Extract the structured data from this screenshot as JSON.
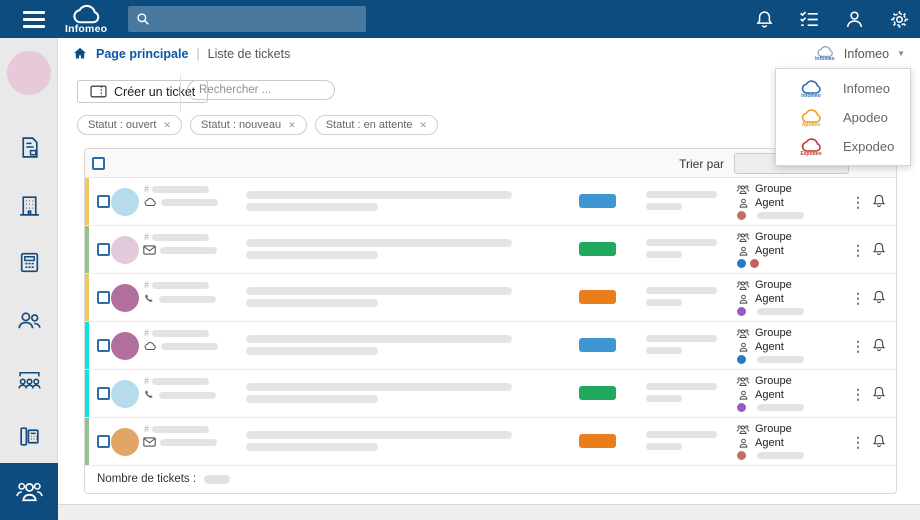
{
  "topbar": {
    "brand": "Infomeo",
    "global_search_value": "",
    "icons": [
      "bell-icon",
      "task-list-icon",
      "user-icon",
      "gear-icon"
    ],
    "color": "#0d4c7e"
  },
  "breadcrumb": {
    "primary": "Page principale",
    "separator": "|",
    "secondary": "Liste de tickets"
  },
  "company_selector": {
    "selected": "Infomeo"
  },
  "company_menu": {
    "items": [
      {
        "label": "Infomeo",
        "logo_color": "#2b6cb5"
      },
      {
        "label": "Apodeo",
        "logo_color": "#f39c12"
      },
      {
        "label": "Expodeo",
        "logo_color": "#c0392b"
      }
    ]
  },
  "toolbar": {
    "create_label": "Créer un ticket",
    "search_placeholder": "Rechercher ..."
  },
  "filters": [
    {
      "label": "Statut : ouvert"
    },
    {
      "label": "Statut : nouveau"
    },
    {
      "label": "Statut : en attente"
    }
  ],
  "sidebar": {
    "avatar_color": "#e7c9d9",
    "items": [
      "document-icon",
      "building-icon",
      "calculator-icon",
      "users-icon",
      "meeting-icon",
      "fax-icon",
      "team-icon"
    ],
    "active_item": "team-icon"
  },
  "table": {
    "sort_label": "Trier par",
    "group_label": "Groupe",
    "agent_label": "Agent",
    "footer_label": "Nombre de tickets :",
    "rows": [
      {
        "accent": "#f1c860",
        "avatar": "#b7dbee",
        "channel": "cloud",
        "badge": "#3e97d3",
        "dots": [
          "#c66d63"
        ],
        "dot_skeleton": true,
        "extra_line": false
      },
      {
        "accent": "#97c08b",
        "avatar": "#e3cadb",
        "channel": "mail",
        "badge": "#21a95f",
        "dots": [
          "#2779c4",
          "#c66161"
        ],
        "dot_skeleton": false,
        "extra_line": false
      },
      {
        "accent": "#f1c860",
        "avatar": "#b16f9d",
        "channel": "phone",
        "badge": "#ea7e1d",
        "dots": [
          "#9c59bd"
        ],
        "dot_skeleton": true,
        "extra_line": true
      },
      {
        "accent": "#0ce3e3",
        "avatar": "#b16f9d",
        "channel": "cloud",
        "badge": "#3e97d3",
        "dots": [
          "#2779c4"
        ],
        "dot_skeleton": true,
        "extra_line": false
      },
      {
        "accent": "#0ce3e3",
        "avatar": "#b7dbee",
        "channel": "phone",
        "badge": "#21a95f",
        "dots": [
          "#9c59bd"
        ],
        "dot_skeleton": true,
        "extra_line": true
      },
      {
        "accent": "#97c08b",
        "avatar": "#e0a567",
        "channel": "mail",
        "badge": "#ea7e1d",
        "dots": [
          "#c66d63"
        ],
        "dot_skeleton": true,
        "extra_line": false
      }
    ]
  }
}
